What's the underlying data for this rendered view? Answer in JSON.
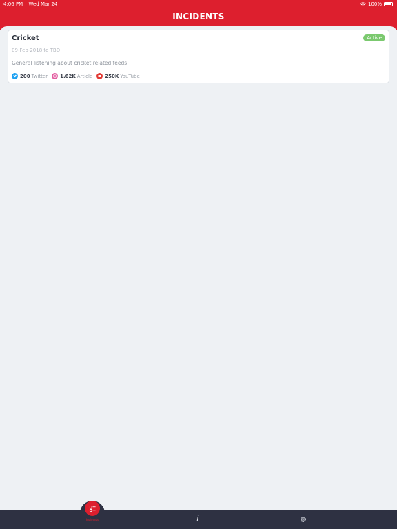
{
  "status_bar": {
    "time": "4:06 PM",
    "date": "Wed Mar 24",
    "battery": "100%"
  },
  "header": {
    "title": "INCIDENTS"
  },
  "incidents": [
    {
      "name": "Cricket",
      "status": "Active",
      "dates": "09-Feb-2018 to TBD",
      "description": "General listening about cricket related feeds",
      "stats": [
        {
          "count": "200",
          "label": "Twitter",
          "icon": "twitter-icon"
        },
        {
          "count": "1.62K",
          "label": "Article",
          "icon": "article-icon"
        },
        {
          "count": "250K",
          "label": "YouTube",
          "icon": "youtube-icon"
        }
      ]
    }
  ],
  "bottom_nav": {
    "items": [
      {
        "icon": "incidents-list-icon",
        "label": "Incidents",
        "active": true
      },
      {
        "icon": "info-icon",
        "glyph": "i",
        "active": false
      },
      {
        "icon": "gear-icon",
        "active": false
      }
    ]
  },
  "colors": {
    "brand_red": "#dd1f2e",
    "active_green": "#7bc96f",
    "nav_dark": "#2e3142",
    "background": "#eef1f4"
  }
}
